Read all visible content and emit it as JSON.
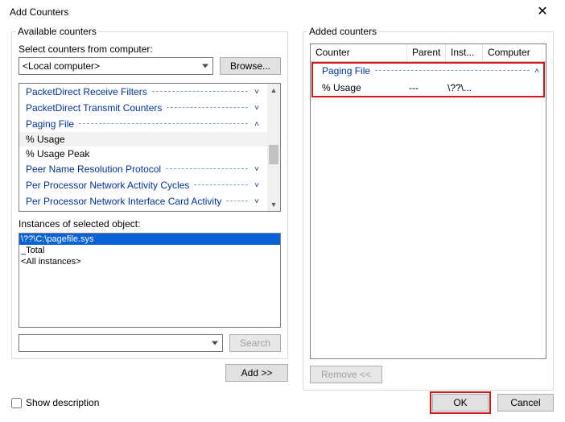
{
  "window": {
    "title": "Add Counters",
    "close_glyph": "✕"
  },
  "left": {
    "group_label": "Available counters",
    "computer_label": "Select counters from computer:",
    "computer_value": "<Local computer>",
    "browse_label": "Browse...",
    "categories": [
      {
        "label": "PacketDirect Receive Filters",
        "state": "collapsed"
      },
      {
        "label": "PacketDirect Transmit Counters",
        "state": "collapsed"
      },
      {
        "label": "Paging File",
        "state": "expanded"
      }
    ],
    "leaves": [
      "% Usage",
      "% Usage Peak"
    ],
    "categories_after": [
      {
        "label": "Peer Name Resolution Protocol",
        "state": "collapsed"
      },
      {
        "label": "Per Processor Network Activity Cycles",
        "state": "collapsed"
      },
      {
        "label": "Per Processor Network Interface Card Activity",
        "state": "collapsed"
      }
    ],
    "instances_label": "Instances of selected object:",
    "instances": [
      {
        "text": "\\??\\C:\\pagefile.sys",
        "selected": true
      },
      {
        "text": "_Total",
        "selected": false
      },
      {
        "text": "<All instances>",
        "selected": false
      }
    ],
    "search_value": "",
    "search_btn": "Search",
    "add_btn": "Add >>"
  },
  "right": {
    "group_label": "Added counters",
    "columns": {
      "counter": "Counter",
      "parent": "Parent",
      "inst": "Inst...",
      "computer": "Computer"
    },
    "group_row": "Paging File",
    "row": {
      "counter": "% Usage",
      "parent": "---",
      "inst": "\\??\\...",
      "computer": ""
    },
    "remove_btn": "Remove <<"
  },
  "bottom": {
    "show_desc": "Show description",
    "ok": "OK",
    "cancel": "Cancel"
  },
  "glyphs": {
    "caret_down": "˅",
    "caret_up": "˄",
    "tri_up": "▲",
    "tri_down": "▼"
  }
}
